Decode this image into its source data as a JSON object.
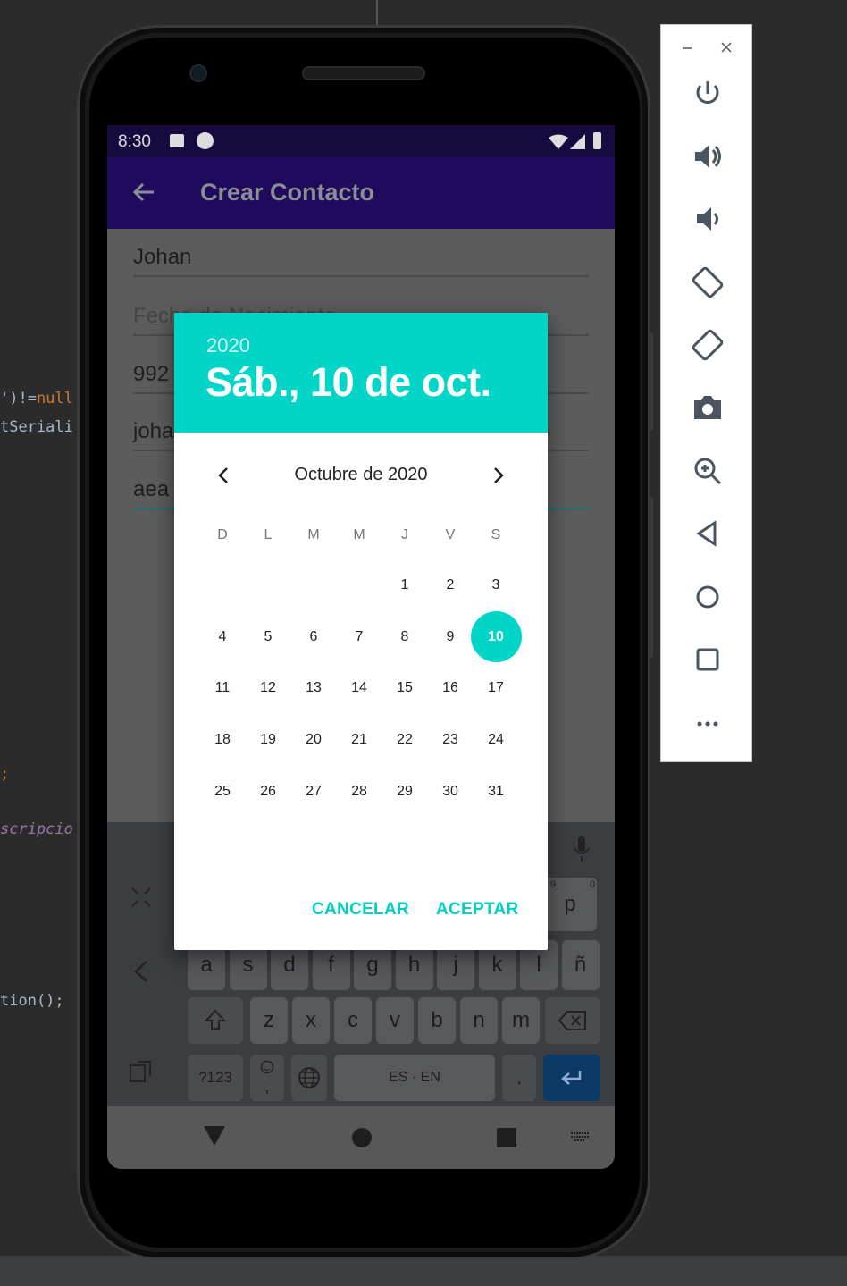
{
  "ide": {
    "line1": "')!=",
    "line1_kw": "null",
    "line2": "tSeriali",
    "line3": ";",
    "line4": "scripcio",
    "line5": "tion();"
  },
  "status": {
    "time": "8:30"
  },
  "appbar": {
    "title": "Crear Contacto"
  },
  "form": {
    "name_value": "Johan",
    "birth_placeholder": "Fecha de Nacimiento",
    "phone_value": "992",
    "email_value": "joha",
    "desc_value": "aea"
  },
  "dialog": {
    "year": "2020",
    "date": "Sáb., 10 de oct.",
    "month": "Octubre de 2020",
    "weekdays": [
      "D",
      "L",
      "M",
      "M",
      "J",
      "V",
      "S"
    ],
    "days": [
      "1",
      "2",
      "3",
      "4",
      "5",
      "6",
      "7",
      "8",
      "9",
      "10",
      "11",
      "12",
      "13",
      "14",
      "15",
      "16",
      "17",
      "18",
      "19",
      "20",
      "21",
      "22",
      "23",
      "24",
      "25",
      "26",
      "27",
      "28",
      "29",
      "30",
      "31"
    ],
    "selected_day": "10",
    "cancel_label": "CANCELAR",
    "accept_label": "ACEPTAR"
  },
  "keyboard": {
    "row2": [
      "a",
      "s",
      "d",
      "f",
      "g",
      "h",
      "j",
      "k",
      "l",
      "ñ"
    ],
    "row3": [
      "z",
      "x",
      "c",
      "v",
      "b",
      "n",
      "m"
    ],
    "p_key": "p",
    "p_hint": "0",
    "o_hint": "9",
    "symbols_label": "?123",
    "comma": ",",
    "space_label": "ES · EN",
    "period": "."
  },
  "colors": {
    "accent": "#00d5c8",
    "appbar": "#1f0a5c",
    "statusbar": "#170a3e"
  }
}
